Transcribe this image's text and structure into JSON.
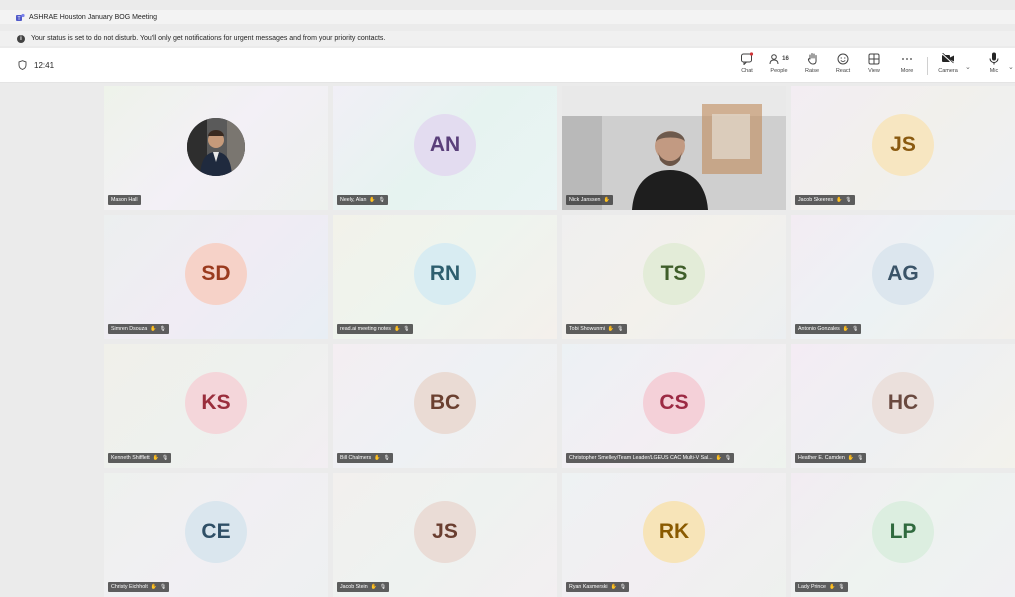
{
  "window": {
    "title": "ASHRAE Houston January BOG Meeting"
  },
  "banner": {
    "text": "Your status is set to do not disturb. You'll only get notifications for urgent messages and from your priority contacts."
  },
  "meeting": {
    "time": "12:41"
  },
  "toolbar": {
    "chat": "Chat",
    "people": "People",
    "people_count": "16",
    "raise": "Raise",
    "react": "React",
    "view": "View",
    "more": "More",
    "camera": "Camera",
    "mic": "Mic"
  },
  "participants": [
    {
      "initials": "",
      "name": "Mason Hall"
    },
    {
      "initials": "AN",
      "name": "Neely, Alan"
    },
    {
      "initials": "",
      "name": "Nick Janssen"
    },
    {
      "initials": "JS",
      "name": "Jacob Skeeres"
    },
    {
      "initials": "SD",
      "name": "Simren Dsouza"
    },
    {
      "initials": "RN",
      "name": "read.ai meeting notes"
    },
    {
      "initials": "TS",
      "name": "Tobi Showunmi"
    },
    {
      "initials": "AG",
      "name": "Antonio Gonzales"
    },
    {
      "initials": "KS",
      "name": "Kenneth Shifflett"
    },
    {
      "initials": "BC",
      "name": "Bill Chalmers"
    },
    {
      "initials": "CS",
      "name": "Christopher Smelley/Team Leader/LGEUS CAC Multi-V Sal..."
    },
    {
      "initials": "HC",
      "name": "Heather E. Camden"
    },
    {
      "initials": "CE",
      "name": "Christy Eichholt"
    },
    {
      "initials": "JS",
      "name": "Jacob Stein"
    },
    {
      "initials": "RK",
      "name": "Ryan Kasmerski"
    },
    {
      "initials": "LP",
      "name": "Lady Prince"
    }
  ],
  "colors": {
    "accent": "#8a8ff0",
    "avatar_AN": "#e3dcf0",
    "text_AN": "#5a3f7a",
    "avatar_JS1": "#f7e6c1",
    "text_JS1": "#8a5a10",
    "avatar_SD": "#f6d2c8",
    "text_SD": "#9a3a1e",
    "avatar_RN": "#d8ecf2",
    "text_RN": "#2d5e6e",
    "avatar_TS": "#e3ecd8",
    "text_TS": "#3f5e2a",
    "avatar_AG": "#dce6ee",
    "text_AG": "#3b5468",
    "avatar_KS": "#f4d6da",
    "text_KS": "#9a2e3c",
    "avatar_BC": "#eadbd4",
    "text_BC": "#6b4030",
    "avatar_CS": "#f4d0d8",
    "text_CS": "#9c2a44",
    "avatar_HC": "#ebe0dc",
    "text_HC": "#6a4a40",
    "avatar_CE": "#dae6ee",
    "text_CE": "#2f4f66",
    "avatar_JS2": "#eadcd6",
    "text_JS2": "#6a3e30",
    "avatar_RK": "#f7e4b8",
    "text_RK": "#8a5a00",
    "avatar_LP": "#dceee0",
    "text_LP": "#2f6a3e"
  }
}
